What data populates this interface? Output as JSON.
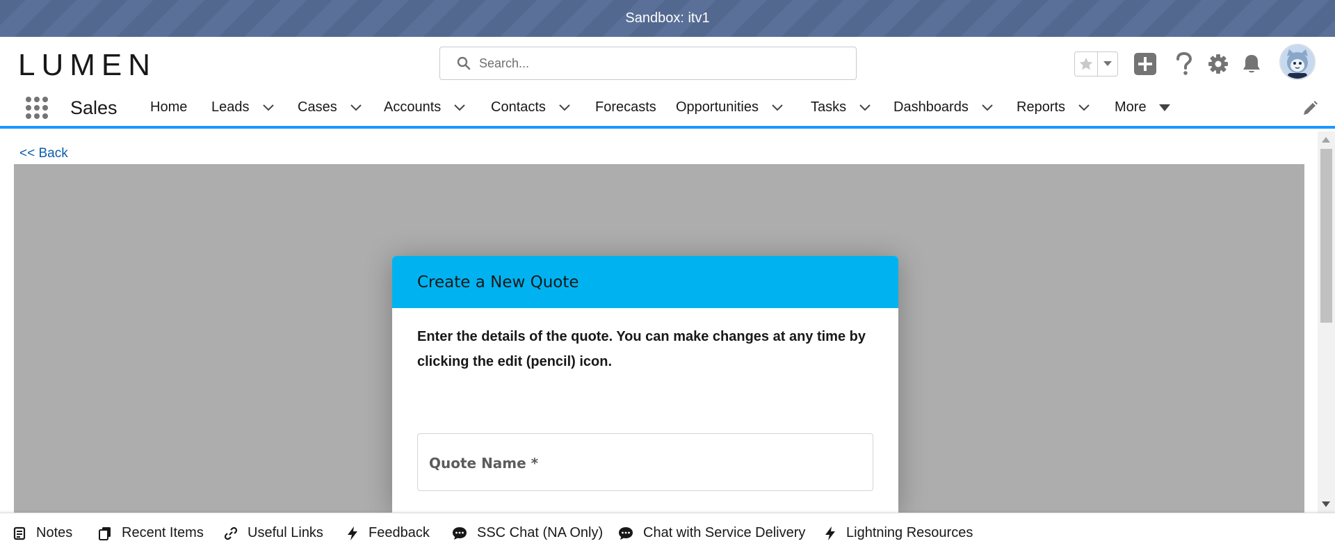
{
  "sandbox": {
    "label": "Sandbox: itv1"
  },
  "header": {
    "logo_text": "LUMEN",
    "search_placeholder": "Search..."
  },
  "nav": {
    "app_name": "Sales",
    "items": [
      {
        "label": "Home",
        "has_menu": false
      },
      {
        "label": "Leads",
        "has_menu": true
      },
      {
        "label": "Cases",
        "has_menu": true
      },
      {
        "label": "Accounts",
        "has_menu": true
      },
      {
        "label": "Contacts",
        "has_menu": true
      },
      {
        "label": "Forecasts",
        "has_menu": false
      },
      {
        "label": "Opportunities",
        "has_menu": true
      },
      {
        "label": "Tasks",
        "has_menu": true
      },
      {
        "label": "Dashboards",
        "has_menu": true
      },
      {
        "label": "Reports",
        "has_menu": true
      },
      {
        "label": "More",
        "has_menu": true
      }
    ]
  },
  "content": {
    "back_link": "<< Back",
    "modal": {
      "title": "Create a New Quote",
      "description": "Enter the details of the quote. You can make changes at any time by clicking the edit (pencil) icon.",
      "field_label": "Quote Name *"
    }
  },
  "utility_bar": {
    "items": [
      {
        "label": "Notes",
        "icon": "notes-icon"
      },
      {
        "label": "Recent Items",
        "icon": "recent-items-icon"
      },
      {
        "label": "Useful Links",
        "icon": "link-icon"
      },
      {
        "label": "Feedback",
        "icon": "lightning-icon"
      },
      {
        "label": "SSC Chat (NA Only)",
        "icon": "chat-icon"
      },
      {
        "label": "Chat with Service Delivery",
        "icon": "chat-icon"
      },
      {
        "label": "Lightning Resources",
        "icon": "lightning-icon"
      }
    ]
  },
  "colors": {
    "modal_header": "#00b3f0",
    "nav_accent": "#1b96ff",
    "link": "#0b5cab",
    "sandbox_bar": "#53688f"
  }
}
